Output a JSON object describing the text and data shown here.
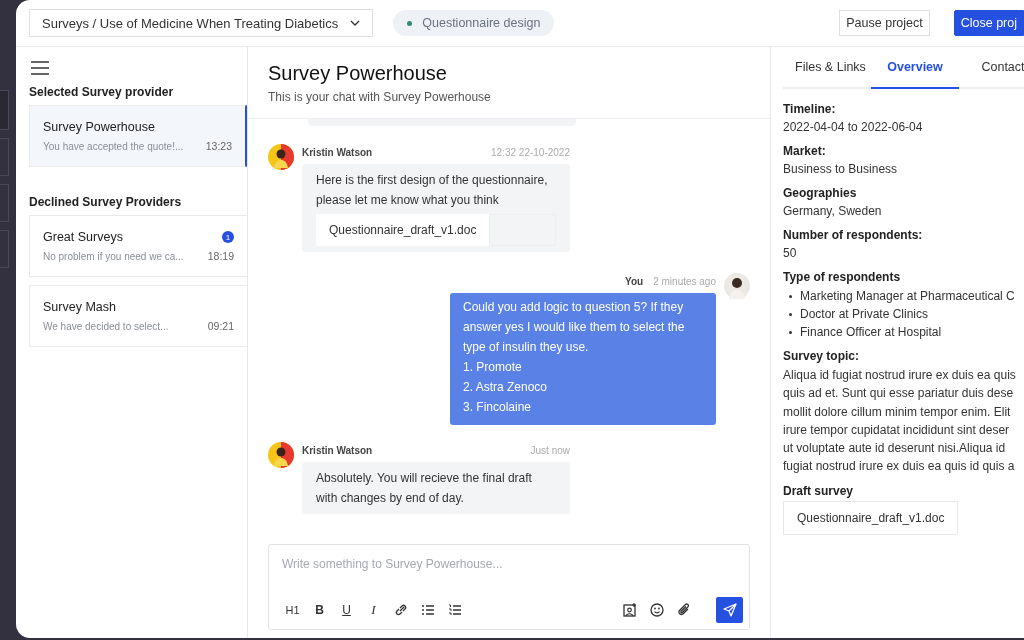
{
  "topbar": {
    "breadcrumb": "Surveys / Use of Medicine When Treating Diabetics",
    "status": {
      "label": "Questionnaire design",
      "color": "#2e8b6e"
    },
    "buttons": [
      {
        "label": "Pause project",
        "kind": "secondary"
      },
      {
        "label": "Close proj",
        "kind": "primary"
      }
    ]
  },
  "sidebar": {
    "sections": [
      {
        "title": "Selected Survey provider",
        "items": [
          {
            "name": "Survey Powerhouse",
            "preview": "You have accepted the quote!...",
            "time": "13:23",
            "selected": true
          }
        ]
      },
      {
        "title": "Declined Survey Providers",
        "items": [
          {
            "name": "Great Surveys",
            "preview": "No problem if you need we ca...",
            "time": "18:19",
            "selected": false,
            "badge": "1"
          },
          {
            "name": "Survey Mash",
            "preview": "We have decided to select...",
            "time": "09:21",
            "selected": false
          }
        ]
      }
    ]
  },
  "chat": {
    "title": "Survey Powerhouse",
    "subtitle": "This is your chat with Survey Powerhouse",
    "messages": [
      {
        "kind": "incoming",
        "author": "Kristin Watson",
        "time": "12:32 22-10-2022",
        "lines": [
          "Here is the first design of the questionnaire,",
          "please let me know what you think"
        ],
        "attachment": "Questionnaire_draft_v1.doc"
      },
      {
        "kind": "outgoing",
        "author": "You",
        "time": "2 minutes ago",
        "lines": [
          "Could you add logic to question 5? If they",
          "answer yes I would like them to select the",
          "type of insulin they use.",
          "1. Promote",
          "2. Astra Zenoco",
          "3. Fincolaine"
        ]
      },
      {
        "kind": "incoming",
        "author": "Kristin Watson",
        "time": "Just now",
        "lines": [
          "Absolutely. You will recieve the final draft",
          "with changes by end of day."
        ]
      }
    ],
    "composer": {
      "placeholder": "Write something to Survey Powerhouse...",
      "tools": [
        {
          "kind": "heading",
          "label": "H1"
        },
        {
          "kind": "bold",
          "label": "B"
        },
        {
          "kind": "underline",
          "label": "U"
        },
        {
          "kind": "italic",
          "label": "I"
        },
        {
          "kind": "link"
        },
        {
          "kind": "bullets"
        },
        {
          "kind": "numbered"
        }
      ],
      "actions": [
        {
          "kind": "image"
        },
        {
          "kind": "emoji"
        },
        {
          "kind": "attach"
        }
      ]
    }
  },
  "details": {
    "tabs": [
      {
        "label": "Files & Links",
        "selected": false
      },
      {
        "label": "Overview",
        "selected": true
      },
      {
        "label": "Contact",
        "selected": false
      }
    ],
    "fields": [
      {
        "kind": "text",
        "label": "Timeline:",
        "value": "2022-04-04 to 2022-06-04"
      },
      {
        "kind": "text",
        "label": "Market:",
        "value": "Business to Business"
      },
      {
        "kind": "text",
        "label": "Geographies",
        "value": "Germany, Sweden"
      },
      {
        "kind": "text",
        "label": "Number of respondents:",
        "value": "50"
      },
      {
        "kind": "list",
        "label": "Type of respondents",
        "items": [
          "Marketing Manager at Pharmaceutical C",
          "Doctor at Private Clinics",
          "Finance Officer at Hospital"
        ]
      },
      {
        "kind": "lines",
        "label": "Survey topic:",
        "lines": [
          "Aliqua id fugiat nostrud irure ex duis ea quis",
          "quis ad et. Sunt qui esse pariatur duis dese",
          "mollit dolore cillum minim tempor enim. Elit",
          "irure tempor cupidatat incididunt sint deser",
          "ut voluptate aute id deserunt nisi.Aliqua id",
          "fugiat nostrud irure ex duis ea quis id quis a"
        ]
      },
      {
        "kind": "file",
        "label": "Draft survey",
        "value": "Questionnaire_draft_v1.doc"
      }
    ]
  }
}
